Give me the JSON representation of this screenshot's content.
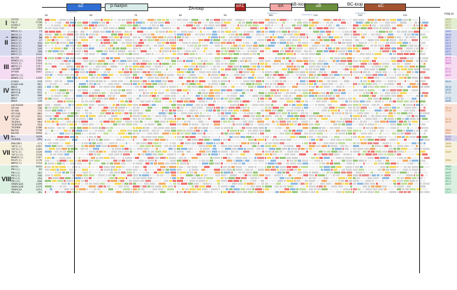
{
  "header": {
    "pdb_id_label": "PDB ID",
    "elements": [
      {
        "label": "αZ",
        "color": "#2f6fd4",
        "text_color": "#ffffff"
      },
      {
        "label": "β-hairpin",
        "color": "#d8ece8",
        "text_color": "#222222"
      },
      {
        "label": "ZA-loop",
        "color": "none",
        "text_color": "#111111"
      },
      {
        "label": "αA1",
        "color": "#a81f1f",
        "text_color": "#ffffff"
      },
      {
        "label": "αA",
        "color": "#f4a7a7",
        "text_color": "#222222"
      },
      {
        "label": "AB-loop",
        "color": "none",
        "text_color": "#111111"
      },
      {
        "label": "αB",
        "color": "#6c8f3d",
        "text_color": "#ffffff"
      },
      {
        "label": "BC-loop",
        "color": "none",
        "text_color": "#111111"
      },
      {
        "label": "αC",
        "color": "#a35230",
        "text_color": "#ffffff"
      }
    ],
    "ruler_ticks": [
      "50",
      "60",
      "70",
      "80",
      "90",
      "100",
      "110",
      "120",
      "130"
    ]
  },
  "groups": [
    {
      "label": "I",
      "band_color": "#e4eed0",
      "pdb_color": "#999966",
      "proteins": [
        [
          "CECR2",
          "428"
        ],
        [
          "FALZ",
          "2790"
        ],
        [
          "GCN5L2",
          "728"
        ],
        [
          "PCAF",
          "725"
        ]
      ],
      "pdb": [
        "3DBB",
        "2SET",
        "3D7C",
        "3GG3"
      ]
    },
    {
      "label": "II",
      "band_color": "#d7d9ee",
      "pdb_color": "#4a66c8",
      "proteins": [
        [
          "BRD2(1)",
          "73"
        ],
        [
          "BRD3(1)",
          "26"
        ],
        [
          "BRD4(1)",
          "50"
        ],
        [
          "BRDT(1)",
          "27"
        ],
        [
          "BRD2(2)",
          "344"
        ],
        [
          "BRD3(2)",
          "308"
        ],
        [
          "BRD4(2)",
          "349"
        ],
        [
          "BRDT(2)",
          "268"
        ],
        [
          "BRDT(2)",
          "1432"
        ]
      ],
      "pdb": [
        "1X0J",
        "2NXB",
        "3MXF",
        "2RFJ",
        "2DVV",
        "2OO1",
        "2OUO",
        "2WP1",
        "2E3K"
      ]
    },
    {
      "label": "III",
      "band_color": "#f5dcf2",
      "pdb_color": "#c040b8",
      "proteins": [
        [
          "BAZ1B",
          "1343"
        ],
        [
          "BRWD3(2)",
          "1304"
        ],
        [
          "PHIP(2)",
          "1318"
        ],
        [
          "WDR9(2)",
          "1317"
        ],
        [
          "CREBBP",
          "1084"
        ],
        [
          "EP300",
          "1047"
        ],
        [
          "BRPF1(1)",
          "",
          "_"
        ],
        [
          "BRWD1(2)",
          "1299"
        ]
      ],
      "pdb": [
        "2DGK",
        "3LF4",
        "3MB3",
        "",
        "3P1C",
        "3I3J",
        "3Q2E",
        ""
      ]
    },
    {
      "label": "IV",
      "band_color": "#dde7ef",
      "pdb_color": "#3a6fa0",
      "proteins": [
        [
          "ATAD2",
          "978"
        ],
        [
          "KIAA1240",
          "981"
        ],
        [
          "BRD1",
          "565"
        ],
        [
          "BRPF1A",
          "632"
        ],
        [
          "BRPF1B",
          "632"
        ],
        [
          "BRPF3",
          "580"
        ],
        [
          "BRD7",
          "129"
        ],
        [
          "BRD9",
          "139"
        ]
      ],
      "pdb": [
        "3DAI",
        "",
        "3RCW",
        "2D9E",
        "3L42",
        "",
        "2I7K",
        "3HME"
      ]
    },
    {
      "label": "V",
      "band_color": "#f9e3d8",
      "pdb_color": "#d07a40",
      "proteins": [
        [
          "LOC93349",
          "469"
        ],
        [
          "SP140",
          "706"
        ],
        [
          "SP100",
          "772"
        ],
        [
          "SP110A",
          "681"
        ],
        [
          "SP110C",
          "631"
        ],
        [
          "TIF1A",
          "865"
        ],
        [
          "TRIM24",
          "904"
        ],
        [
          "TRIM33B",
          "910"
        ],
        [
          "TRIM66",
          "1286"
        ],
        [
          "BAZ2A",
          "1796"
        ],
        [
          "BAZ2B",
          "2055"
        ]
      ],
      "pdb": [
        "",
        "2DLN",
        "2YYU",
        "",
        "",
        "3O33",
        "3O34",
        "",
        "",
        "3MQM",
        "3G0L"
      ]
    },
    {
      "label": "VI",
      "band_color": "#dad7ea",
      "pdb_color": "#5a4fa0",
      "proteins": [
        [
          "MLL",
          "1628"
        ],
        [
          "TRIM28",
          "694"
        ]
      ],
      "pdb": [
        "3LQJ",
        "2RO1"
      ]
    },
    {
      "label": "VII",
      "band_color": "#f7f1dc",
      "pdb_color": "#b08e30",
      "proteins": [
        [
          "PRKCBP1",
          "171"
        ],
        [
          "TAF1(1)",
          "1397"
        ],
        [
          "TAF1L(1)",
          "1403"
        ],
        [
          "TAF1(2)",
          "1520"
        ],
        [
          "TAF1L(2)",
          "1526"
        ],
        [
          "BRWD3(1)",
          "1167"
        ],
        [
          "PHIP(1)",
          "1176"
        ],
        [
          "WDR9(1)",
          "1194"
        ]
      ],
      "pdb": [
        "2DKW",
        "3AAD",
        "",
        "3AAD",
        "",
        "",
        "3MB4",
        ""
      ]
    },
    {
      "label": "VIII",
      "band_color": "#dcf0e2",
      "pdb_color": "#2f9a6a",
      "proteins": [
        [
          "ASH1L",
          "2633"
        ],
        [
          "PB1(1)",
          "63"
        ],
        [
          "PB1(2)",
          "201"
        ],
        [
          "PB1(3)",
          "356"
        ],
        [
          "PB1(4)",
          "494"
        ],
        [
          "PB1(5)",
          "656"
        ],
        [
          "SMARCA2A",
          "1399"
        ],
        [
          "SMARCA2B",
          "1379"
        ],
        [
          "SMARCA4",
          "1451"
        ],
        [
          "PB1(6)",
          "781"
        ]
      ],
      "pdb": [
        "3MQM",
        "3IU5",
        "3HMF",
        "3G0J",
        "3MB4",
        "3K2J",
        "2DAT",
        "",
        "2GRC",
        "3TLP"
      ]
    }
  ],
  "highlight_row": {
    "group": 1,
    "index": 2
  }
}
